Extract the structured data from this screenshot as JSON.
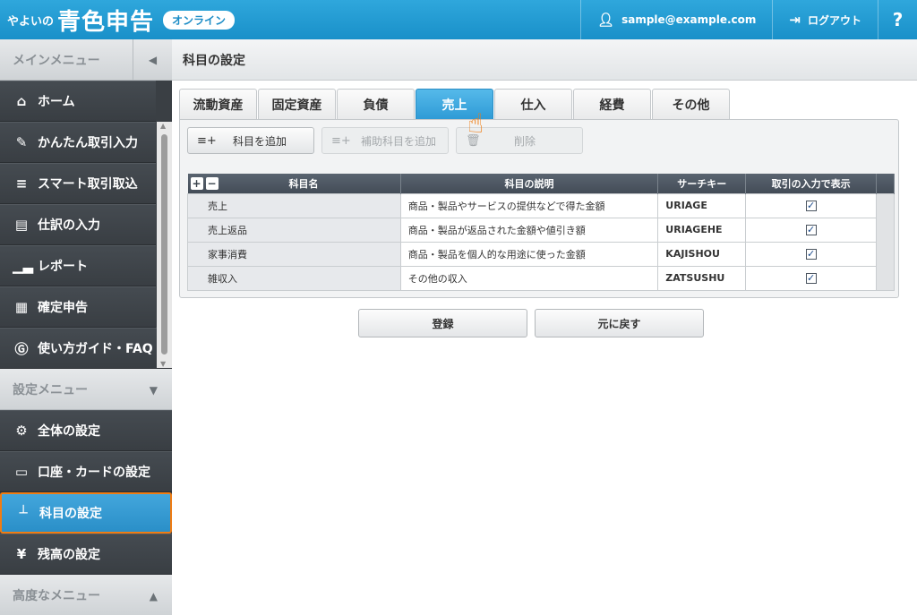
{
  "header": {
    "logo_sub": "やよいの",
    "logo_main": "青色申告",
    "badge": "オンライン",
    "user_email": "sample@example.com",
    "logout_label": "ログアウト",
    "help_label": "?"
  },
  "sidebar": {
    "main_menu_label": "メインメニュー",
    "main_items": [
      {
        "label": "ホーム",
        "icon": "home-icon"
      },
      {
        "label": "かんたん取引入力",
        "icon": "pencil-icon"
      },
      {
        "label": "スマート取引取込",
        "icon": "import-icon"
      },
      {
        "label": "仕訳の入力",
        "icon": "journal-icon"
      },
      {
        "label": "レポート",
        "icon": "report-icon"
      },
      {
        "label": "確定申告",
        "icon": "calculator-icon"
      },
      {
        "label": "使い方ガイド・FAQ",
        "icon": "help-circle-icon"
      }
    ],
    "settings_menu_label": "設定メニュー",
    "settings_items": [
      {
        "label": "全体の設定",
        "icon": "settings-doc-icon"
      },
      {
        "label": "口座・カードの設定",
        "icon": "card-icon"
      },
      {
        "label": "科目の設定",
        "icon": "hierarchy-icon"
      },
      {
        "label": "残高の設定",
        "icon": "yen-icon"
      }
    ],
    "advanced_menu_label": "高度なメニュー"
  },
  "main": {
    "title": "科目の設定",
    "tabs": [
      "流動資産",
      "固定資産",
      "負債",
      "売上",
      "仕入",
      "経費",
      "その他"
    ],
    "active_tab": "売上",
    "toolbar": {
      "add": "科目を追加",
      "add_sub": "補助科目を追加",
      "delete": "削除"
    },
    "table": {
      "headers": [
        "科目名",
        "科目の説明",
        "サーチキー",
        "取引の入力で表示"
      ],
      "rows": [
        {
          "name": "売上",
          "desc": "商品・製品やサービスの提供などで得た金額",
          "key": "URIAGE",
          "show": true
        },
        {
          "name": "売上返品",
          "desc": "商品・製品が返品された金額や値引き額",
          "key": "URIAGEHE",
          "show": true
        },
        {
          "name": "家事消費",
          "desc": "商品・製品を個人的な用途に使った金額",
          "key": "KAJISHOU",
          "show": true
        },
        {
          "name": "雑収入",
          "desc": "その他の収入",
          "key": "ZATSUSHU",
          "show": true
        }
      ]
    },
    "actions": {
      "register": "登録",
      "revert": "元に戻す"
    }
  },
  "colors": {
    "header_blue": "#1990c9",
    "active_blue": "#2f9bd6",
    "highlight_orange": "#f07c12"
  }
}
